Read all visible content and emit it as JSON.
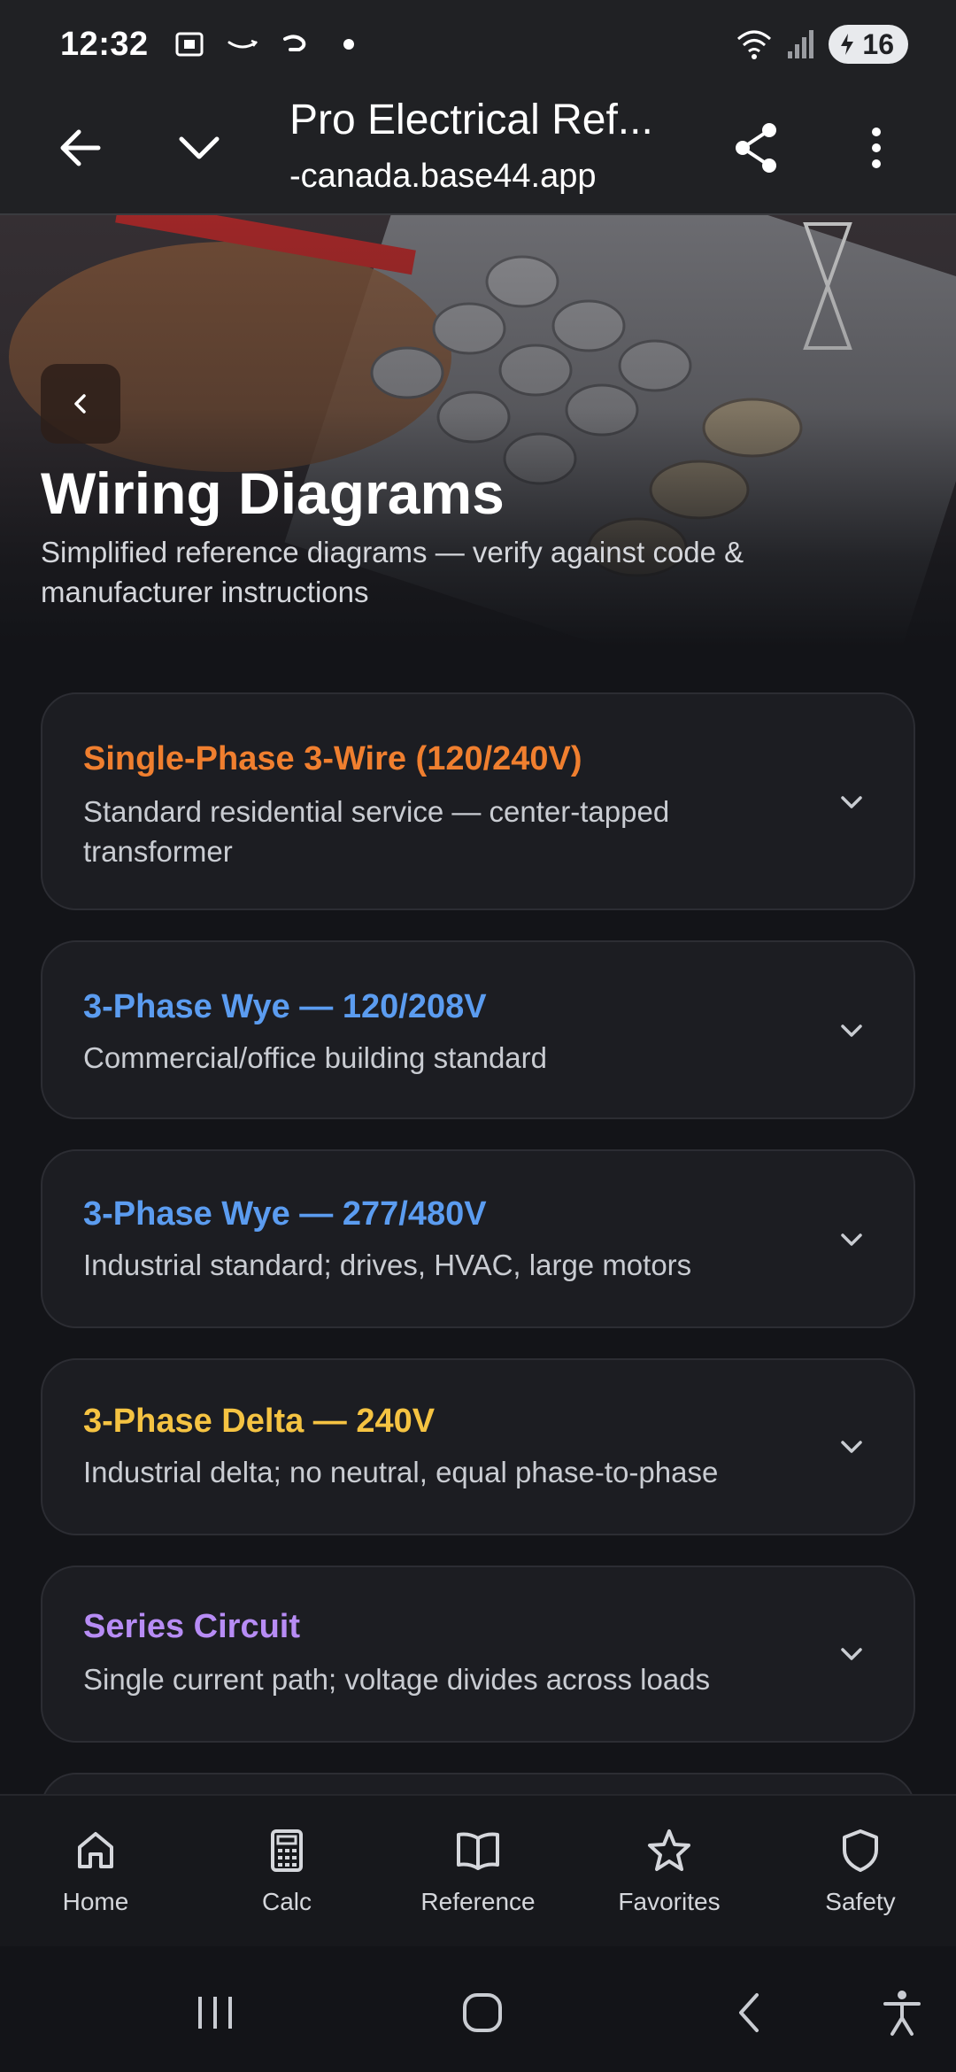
{
  "status_bar": {
    "time": "12:32",
    "battery": "16",
    "icons_left": [
      "screenshot-icon",
      "amazon-icon",
      "notification-icon",
      "dot-icon"
    ],
    "icons_right": [
      "wifi-icon",
      "signal-icon",
      "battery-icon"
    ]
  },
  "browser": {
    "title": "Pro Electrical Ref...",
    "url": "-canada.base44.app"
  },
  "hero": {
    "title": "Wiring Diagrams",
    "subtitle": "Simplified reference diagrams — verify against code & manufacturer instructions"
  },
  "colors": {
    "orange": "#f07f2f",
    "blue": "#5b9cf0",
    "yellow": "#f5c342",
    "purple": "#b78cf5"
  },
  "cards": [
    {
      "title": "Single-Phase 3-Wire (120/240V)",
      "description": "Standard residential service — center-tapped transformer",
      "color": "#f07f2f"
    },
    {
      "title": "3-Phase Wye — 120/208V",
      "description": "Commercial/office building standard",
      "color": "#5b9cf0"
    },
    {
      "title": "3-Phase Wye — 277/480V",
      "description": "Industrial standard; drives, HVAC, large motors",
      "color": "#5b9cf0"
    },
    {
      "title": "3-Phase Delta — 240V",
      "description": "Industrial delta; no neutral, equal phase-to-phase",
      "color": "#f5c342"
    },
    {
      "title": "Series Circuit",
      "description": "Single current path; voltage divides across loads",
      "color": "#b78cf5"
    }
  ],
  "bottom_nav": [
    {
      "label": "Home",
      "icon": "home-icon"
    },
    {
      "label": "Calc",
      "icon": "calculator-icon"
    },
    {
      "label": "Reference",
      "icon": "book-icon"
    },
    {
      "label": "Favorites",
      "icon": "star-icon"
    },
    {
      "label": "Safety",
      "icon": "shield-icon"
    }
  ]
}
